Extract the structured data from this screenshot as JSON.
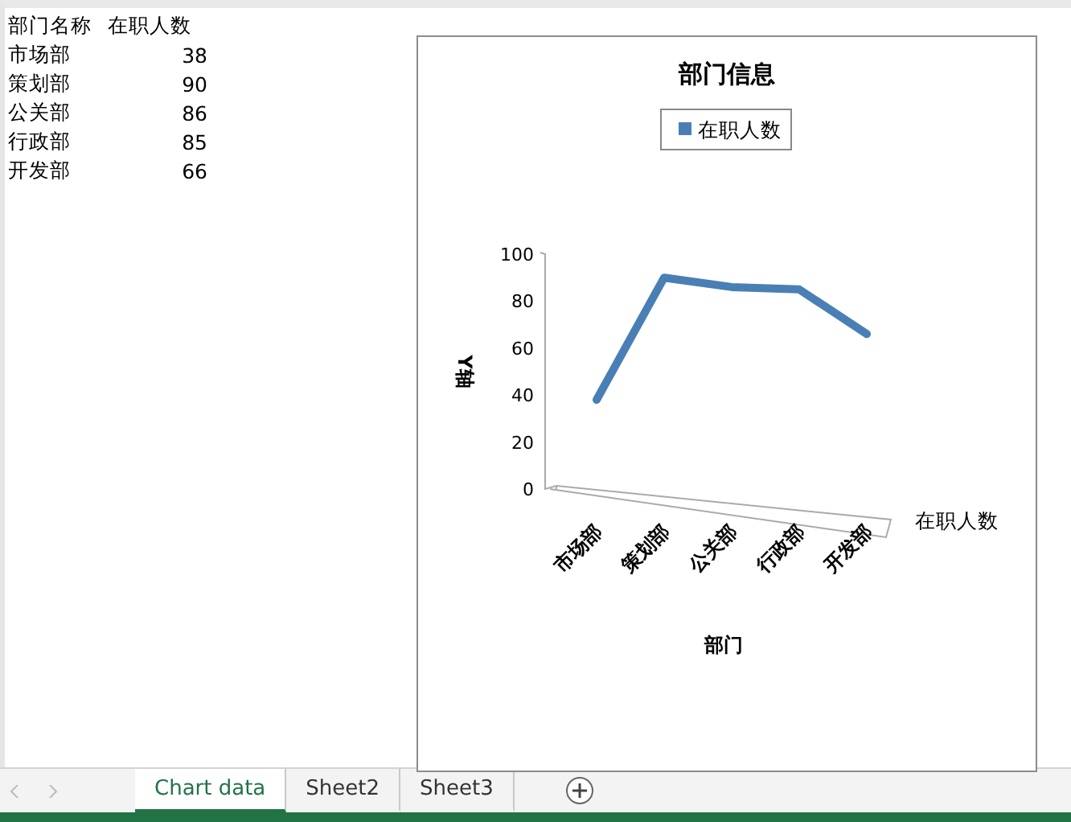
{
  "sheet": {
    "header": [
      "部门名称",
      "在职人数"
    ],
    "rows": [
      [
        "市场部",
        "38"
      ],
      [
        "策划部",
        "90"
      ],
      [
        "公关部",
        "86"
      ],
      [
        "行政部",
        "85"
      ],
      [
        "开发部",
        "66"
      ]
    ]
  },
  "chart": {
    "chart_data": {
      "type": "line",
      "title": "部门信息",
      "xlabel": "部门",
      "ylabel": "Y轴",
      "categories": [
        "市场部",
        "策划部",
        "公关部",
        "行政部",
        "开发部"
      ],
      "series": [
        {
          "name": "在职人数",
          "color": "#4a7fb5",
          "values": [
            38,
            90,
            86,
            85,
            66
          ]
        }
      ],
      "ylim": [
        0,
        100
      ],
      "yticks": [
        0,
        20,
        40,
        60,
        80,
        100
      ]
    },
    "depth_label": "在职人数"
  },
  "tabs": [
    {
      "label": "Chart data",
      "selected": true
    },
    {
      "label": "Sheet2",
      "selected": false
    },
    {
      "label": "Sheet3",
      "selected": false
    }
  ]
}
